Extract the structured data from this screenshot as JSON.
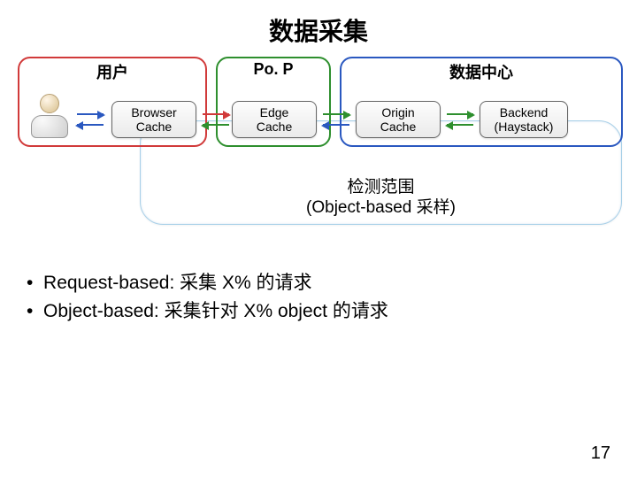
{
  "title": "数据采集",
  "columns": {
    "user": "用户",
    "pop": "Po. P",
    "datacenter": "数据中心"
  },
  "nodes": {
    "browser_cache": "Browser\nCache",
    "edge_cache": "Edge\nCache",
    "origin_cache": "Origin\nCache",
    "backend": "Backend\n(Haystack)"
  },
  "scope": {
    "line1": "检测范围",
    "line2": "(Object-based 采样)"
  },
  "bullets": [
    "Request-based: 采集 X% 的请求",
    "Object-based: 采集针对 X% object 的请求"
  ],
  "page_number": "17"
}
